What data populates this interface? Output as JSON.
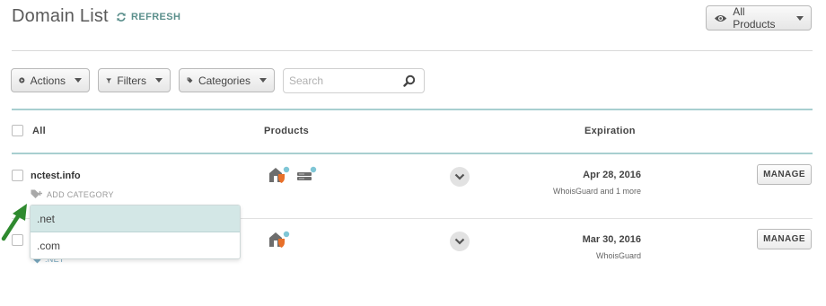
{
  "header": {
    "title": "Domain List",
    "refresh_label": "REFRESH",
    "all_products_label": "All Products"
  },
  "toolbar": {
    "actions_label": "Actions",
    "filters_label": "Filters",
    "categories_label": "Categories",
    "search_placeholder": "Search"
  },
  "table": {
    "columns": {
      "all": "All",
      "products": "Products",
      "expiration": "Expiration"
    },
    "rows": [
      {
        "domain": "nctest.info",
        "add_category_label": "ADD CATEGORY",
        "expiration": "Apr 28, 2016",
        "services": "WhoisGuard and 1 more",
        "manage_label": "MANAGE"
      },
      {
        "domain": "",
        "category_tag": ".NET",
        "expiration": "Mar 30, 2016",
        "services": "WhoisGuard",
        "manage_label": "MANAGE"
      }
    ]
  },
  "category_dropdown": {
    "options": [
      ".net",
      ".com"
    ],
    "selected": ".net"
  },
  "colors": {
    "accent_teal": "#5b8f8c",
    "arrow_green": "#2f8a2f",
    "divider_teal": "#a8cfd0",
    "badge_blue": "#7fc6d6",
    "shield_orange": "#e8702a"
  },
  "icons": [
    "refresh-icon",
    "eye-icon",
    "play-circle-icon",
    "filter-icon",
    "tag-icon",
    "search-icon",
    "home-shield-icon",
    "server-icon",
    "chevron-down-icon",
    "arrow-icon"
  ]
}
